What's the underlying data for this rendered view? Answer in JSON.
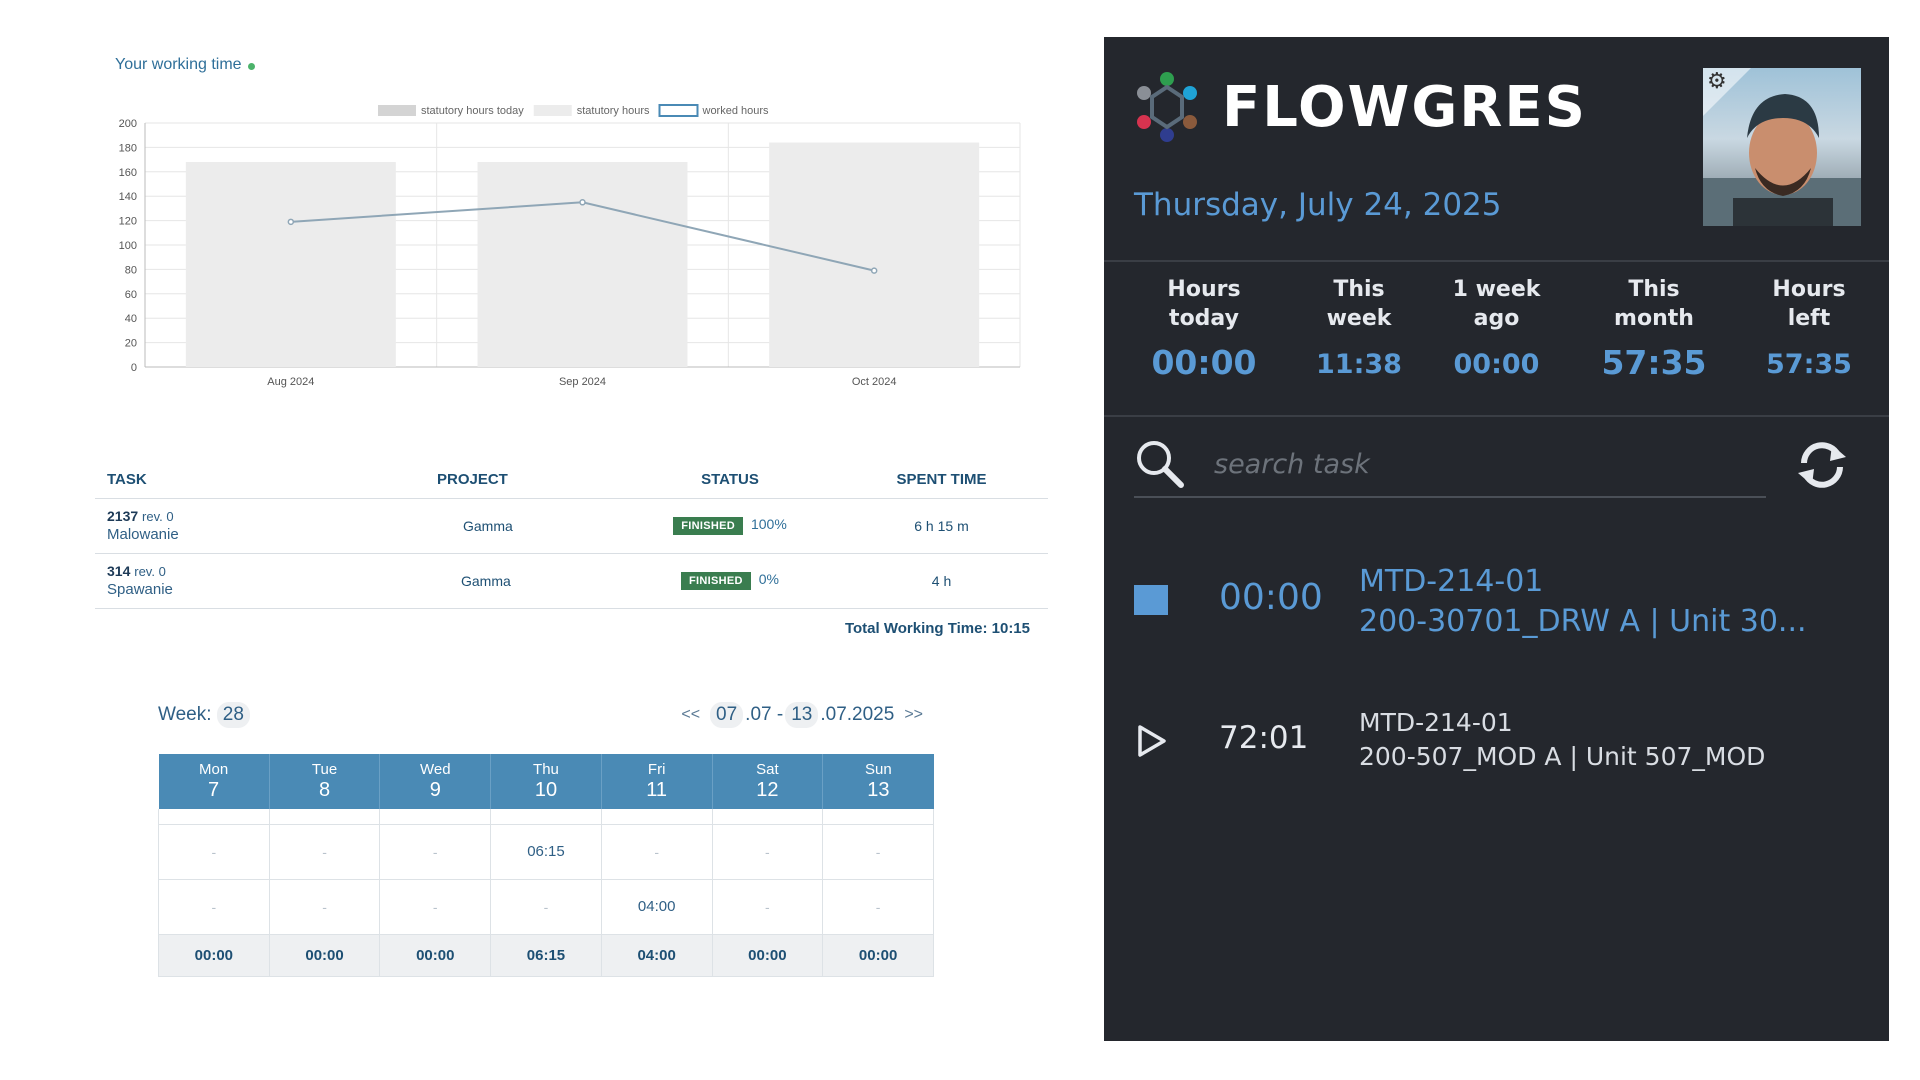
{
  "chart_section": {
    "title": "Your working time",
    "chart_data": {
      "type": "bar",
      "categories": [
        "Aug 2024",
        "Sep 2024",
        "Oct 2024"
      ],
      "series": [
        {
          "name": "statutory hours today",
          "kind": "bar",
          "color": "#d4d4d4",
          "values": [
            null,
            null,
            null
          ]
        },
        {
          "name": "statutory hours",
          "kind": "bar",
          "color": "#ececec",
          "values": [
            168,
            168,
            184
          ]
        },
        {
          "name": "worked hours",
          "kind": "line",
          "color": "#8fa6b6",
          "values": [
            119,
            135,
            79
          ]
        }
      ],
      "ylim": [
        0,
        200
      ],
      "yticks": [
        0,
        20,
        40,
        60,
        80,
        100,
        120,
        140,
        160,
        180,
        200
      ],
      "grid": true,
      "legend_position": "top-center"
    }
  },
  "tasks_table": {
    "headers": {
      "task": "TASK",
      "project": "PROJECT",
      "status": "STATUS",
      "spent": "SPENT TIME"
    },
    "rows": [
      {
        "id": "2137",
        "rev": "rev. 0",
        "name": "Malowanie",
        "project": "Gamma",
        "status": "FINISHED",
        "percent": "100%",
        "spent": "6 h 15 m"
      },
      {
        "id": "314",
        "rev": "rev. 0",
        "name": "Spawanie",
        "project": "Gamma",
        "status": "FINISHED",
        "percent": "0%",
        "spent": "4 h"
      }
    ],
    "total": "Total Working Time: 10:15"
  },
  "week": {
    "label": "Week:",
    "number": "28",
    "prev": "<<",
    "next": ">>",
    "start_day": "07",
    "start_rest": ".07 -",
    "end_day": "13",
    "end_rest": ".07.2025",
    "days": [
      {
        "name": "Mon",
        "date": "7"
      },
      {
        "name": "Tue",
        "date": "8"
      },
      {
        "name": "Wed",
        "date": "9"
      },
      {
        "name": "Thu",
        "date": "10"
      },
      {
        "name": "Fri",
        "date": "11"
      },
      {
        "name": "Sat",
        "date": "12"
      },
      {
        "name": "Sun",
        "date": "13"
      }
    ],
    "rows": [
      [
        "-",
        "-",
        "-",
        "06:15",
        "-",
        "-",
        "-"
      ],
      [
        "-",
        "-",
        "-",
        "-",
        "04:00",
        "-",
        "-"
      ]
    ],
    "totals": [
      "00:00",
      "00:00",
      "00:00",
      "06:15",
      "04:00",
      "00:00",
      "00:00"
    ]
  },
  "panel": {
    "brand": "FLOWGRES",
    "date": "Thursday, July 24, 2025",
    "stats": [
      {
        "label": "Hours\ntoday",
        "value": "00:00"
      },
      {
        "label": "This\nweek",
        "value": "11:38"
      },
      {
        "label": "1 week\nago",
        "value": "00:00"
      },
      {
        "label": "This\nmonth",
        "value": "57:35"
      },
      {
        "label": "Hours\nleft",
        "value": "57:35"
      }
    ],
    "search": {
      "placeholder": "search task"
    },
    "tasks": [
      {
        "state": "running",
        "time": "00:00",
        "line1": "MTD-214-01",
        "line2": "200-30701_DRW A | Unit 30..."
      },
      {
        "state": "stopped",
        "time": "72:01",
        "line1": "MTD-214-01",
        "line2": "200-507_MOD A | Unit 507_MOD"
      }
    ],
    "accent": "#5a9ad5",
    "background": "#24272d"
  }
}
